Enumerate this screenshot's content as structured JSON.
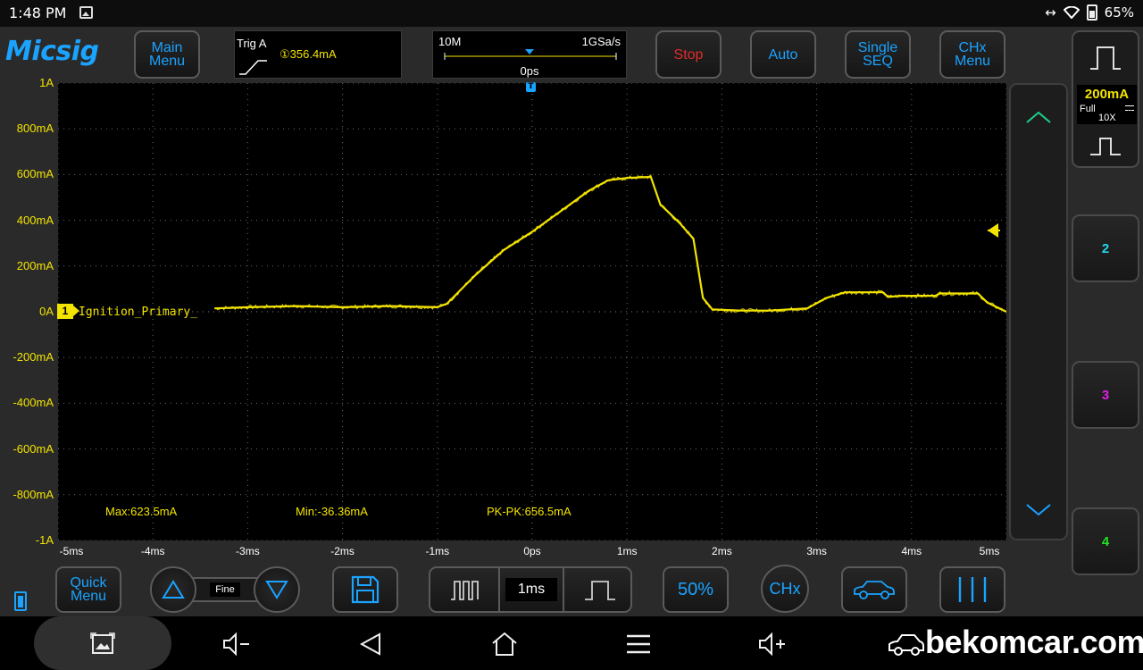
{
  "status_bar": {
    "time": "1:48 PM",
    "battery": "65%",
    "icons": [
      "gallery-icon",
      "rotate-icon",
      "wifi-icon",
      "battery-icon"
    ]
  },
  "toolbar": {
    "logo": "Micsig",
    "main_menu": [
      "Main",
      "Menu"
    ],
    "trigger": {
      "title": "Trig A",
      "level": "①356.4mA",
      "edge": "rising-edge-icon"
    },
    "timebase": {
      "memory": "10M",
      "sample_rate": "1GSa/s",
      "position": "0ps"
    },
    "stop": "Stop",
    "auto": "Auto",
    "single_seq": [
      "Single",
      "SEQ"
    ],
    "chx_menu": [
      "CHx",
      "Menu"
    ]
  },
  "scope": {
    "channel_number": "1",
    "channel_name": "Ignition_Primary_",
    "trigger_marker": "T",
    "y_labels": [
      "1A",
      "800mA",
      "600mA",
      "400mA",
      "200mA",
      "0A",
      "-200mA",
      "-400mA",
      "-600mA",
      "-800mA",
      "-1A"
    ],
    "x_labels": [
      "-5ms",
      "-4ms",
      "-3ms",
      "-2ms",
      "-1ms",
      "0ps",
      "1ms",
      "2ms",
      "3ms",
      "4ms",
      "5ms"
    ],
    "measurements": {
      "max": "Max:623.5mA",
      "min": "Min:-36.36mA",
      "pkpk": "PK-PK:656.5mA"
    },
    "trace_color": "#f2e300",
    "waveform_ma": [
      {
        "t": -3.35,
        "v": 15
      },
      {
        "t": -3.0,
        "v": 20
      },
      {
        "t": -2.5,
        "v": 25
      },
      {
        "t": -2.0,
        "v": 20
      },
      {
        "t": -1.5,
        "v": 25
      },
      {
        "t": -1.0,
        "v": 20
      },
      {
        "t": -0.9,
        "v": 35
      },
      {
        "t": -0.6,
        "v": 160
      },
      {
        "t": -0.3,
        "v": 270
      },
      {
        "t": 0.0,
        "v": 350
      },
      {
        "t": 0.3,
        "v": 440
      },
      {
        "t": 0.6,
        "v": 530
      },
      {
        "t": 0.8,
        "v": 575
      },
      {
        "t": 1.0,
        "v": 585
      },
      {
        "t": 1.25,
        "v": 590
      },
      {
        "t": 1.35,
        "v": 470
      },
      {
        "t": 1.55,
        "v": 390
      },
      {
        "t": 1.7,
        "v": 320
      },
      {
        "t": 1.8,
        "v": 60
      },
      {
        "t": 1.9,
        "v": 10
      },
      {
        "t": 2.2,
        "v": 5
      },
      {
        "t": 2.5,
        "v": 5
      },
      {
        "t": 2.9,
        "v": 15
      },
      {
        "t": 3.1,
        "v": 60
      },
      {
        "t": 3.3,
        "v": 85
      },
      {
        "t": 3.7,
        "v": 85
      },
      {
        "t": 3.75,
        "v": 65
      },
      {
        "t": 3.9,
        "v": 70
      },
      {
        "t": 4.25,
        "v": 70
      },
      {
        "t": 4.3,
        "v": 80
      },
      {
        "t": 4.7,
        "v": 80
      },
      {
        "t": 4.8,
        "v": 40
      },
      {
        "t": 5.0,
        "v": 0
      }
    ]
  },
  "right_panel": {
    "ch1_scale": "200mA",
    "ch1_bw": "Full",
    "ch1_probe": "10X",
    "ch1_color": "#f2e300",
    "channels": [
      {
        "label": "2",
        "color": "#22d8f0"
      },
      {
        "label": "3",
        "color": "#e020e0"
      },
      {
        "label": "4",
        "color": "#22e022"
      }
    ]
  },
  "bottom": {
    "quick_menu": [
      "Quick",
      "Menu"
    ],
    "fine": "Fine",
    "timebase": "1ms",
    "fifty": "50%",
    "chx": "CHx"
  },
  "navbar": {
    "watermark": "bekomcar.com"
  }
}
